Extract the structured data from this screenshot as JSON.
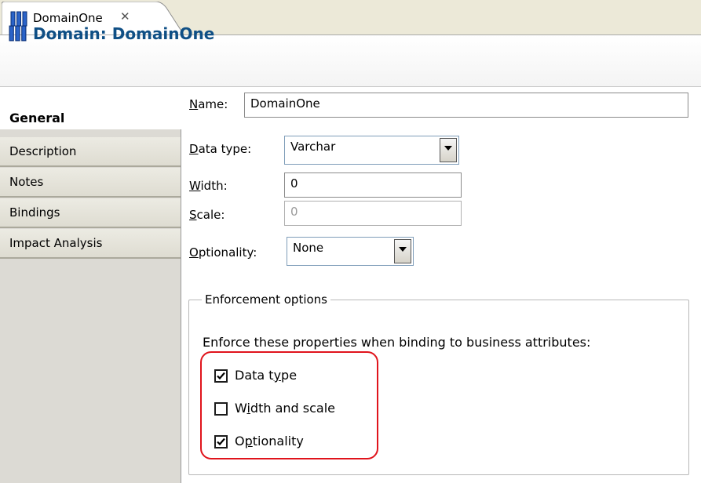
{
  "editor_tab": {
    "label": "DomainOne",
    "close_glyph": "✕",
    "icon": "domain-columns-icon"
  },
  "header": {
    "title": "Domain: DomainOne",
    "icon": "domain-columns-icon",
    "title_color": "#0f4f85"
  },
  "sidebar": {
    "items": [
      {
        "label": "General",
        "active": true
      },
      {
        "label": "Description",
        "active": false
      },
      {
        "label": "Notes",
        "active": false
      },
      {
        "label": "Bindings",
        "active": false
      },
      {
        "label": "Impact Analysis",
        "active": false
      }
    ]
  },
  "form": {
    "name": {
      "label_mnemonic": "N",
      "label_rest": "ame:",
      "value": "DomainOne"
    },
    "data_type": {
      "label_mnemonic": "D",
      "label_rest": "ata type:",
      "value": "Varchar"
    },
    "width": {
      "label_mnemonic": "W",
      "label_rest": "idth:",
      "value": "0"
    },
    "scale": {
      "label_mnemonic": "S",
      "label_rest": "cale:",
      "value": "0",
      "disabled": true
    },
    "optionality": {
      "label_mnemonic": "O",
      "label_rest": "ptionality:",
      "value": "None"
    }
  },
  "enforcement": {
    "legend": "Enforcement options",
    "description": "Enforce these properties when binding to business attributes:",
    "highlight_color": "#e0141c",
    "options": [
      {
        "label_pre": "Data t",
        "label_mnemonic": "y",
        "label_post": "pe",
        "checked": true
      },
      {
        "label_pre": "W",
        "label_mnemonic": "i",
        "label_post": "dth and scale",
        "checked": false
      },
      {
        "label_pre": "O",
        "label_mnemonic": "p",
        "label_post": "tionality",
        "checked": true
      }
    ]
  }
}
